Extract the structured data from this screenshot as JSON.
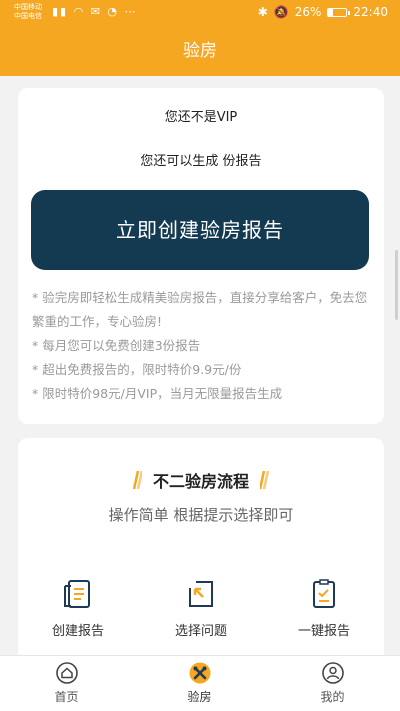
{
  "status_bar": {
    "carrier_1": "中国移动",
    "carrier_2": "中国电信",
    "battery_percent": "26%",
    "battery_level": 0.26,
    "time": "22:40"
  },
  "header": {
    "title": "验房"
  },
  "vip_card": {
    "status": "您还不是VIP",
    "remaining": "您还可以生成 份报告",
    "create_button": "立即创建验房报告",
    "notes": [
      "* 验完房即轻松生成精美验房报告，直接分享给客户，免去您繁重的工作，专心验房!",
      "* 每月您可以免费创建3份报告",
      "* 超出免费报告的，限时特价9.9元/份",
      "* 限时特价98元/月VIP，当月无限量报告生成"
    ]
  },
  "flow_card": {
    "title": "不二验房流程",
    "subtitle": "操作简单 根据提示选择即可",
    "steps": [
      {
        "label": "创建报告",
        "icon": "document-icon"
      },
      {
        "label": "选择问题",
        "icon": "select-icon"
      },
      {
        "label": "一键报告",
        "icon": "checklist-icon"
      }
    ]
  },
  "tabs": [
    {
      "label": "首页",
      "icon": "home-icon"
    },
    {
      "label": "验房",
      "icon": "tools-icon",
      "active": true
    },
    {
      "label": "我的",
      "icon": "user-icon"
    }
  ],
  "colors": {
    "accent": "#f5a722",
    "button": "#143a52",
    "icon": "#1e3a55"
  }
}
